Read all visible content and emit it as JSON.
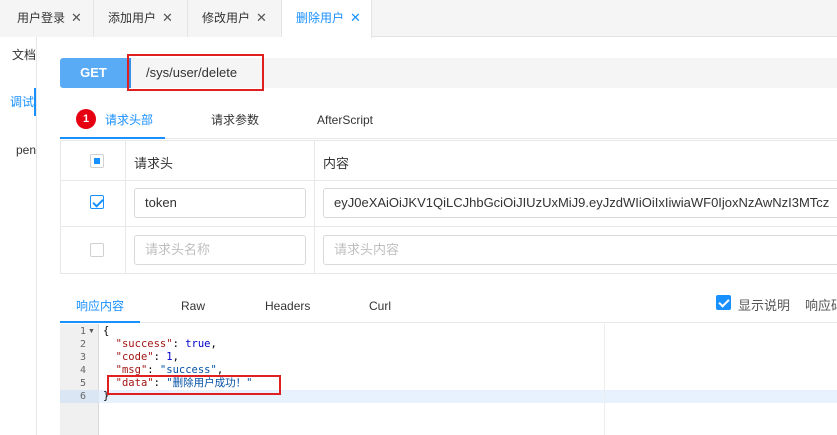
{
  "tabs": [
    {
      "label": "用户登录"
    },
    {
      "label": "添加用户"
    },
    {
      "label": "修改用户"
    },
    {
      "label": "删除用户"
    }
  ],
  "close_glyph": "✕",
  "left_menu": [
    {
      "label": "文档"
    },
    {
      "label": "调试"
    },
    {
      "label": "pen"
    }
  ],
  "request": {
    "method": "GET",
    "url": "/sys/user/delete"
  },
  "request_tabs": {
    "badge": "1",
    "items": [
      {
        "label": "请求头部"
      },
      {
        "label": "请求参数"
      },
      {
        "label": "AfterScript"
      }
    ]
  },
  "header_table": {
    "col_name": "请求头",
    "col_value": "内容",
    "rows": [
      {
        "name": "token",
        "value": "eyJ0eXAiOiJKV1QiLCJhbGciOiJIUzUxMiJ9.eyJzdWIiOiIxIiwiaWF0IjoxNzAwNzI3MTcz"
      }
    ],
    "name_placeholder": "请求头名称",
    "value_placeholder": "请求头内容"
  },
  "response_tabs": [
    {
      "label": "响应内容"
    },
    {
      "label": "Raw"
    },
    {
      "label": "Headers"
    },
    {
      "label": "Curl"
    }
  ],
  "show_description_label": "显示说明",
  "response_extra_label": "响应码",
  "response_code": {
    "open_brace": "{",
    "close_brace": "}",
    "lines": [
      {
        "key": "\"success\"",
        "value": "true"
      },
      {
        "key": "\"code\"",
        "value": "1"
      },
      {
        "key": "\"msg\"",
        "value": "\"success\""
      },
      {
        "key": "\"data\"",
        "value": "\"删除用户成功！\""
      }
    ],
    "line_numbers": [
      "1",
      "2",
      "3",
      "4",
      "5",
      "6"
    ]
  },
  "colors": {
    "accent": "#1890ff",
    "method_bg": "#5aabf5",
    "badge": "#e60012",
    "highlight_box": "#e02020"
  }
}
